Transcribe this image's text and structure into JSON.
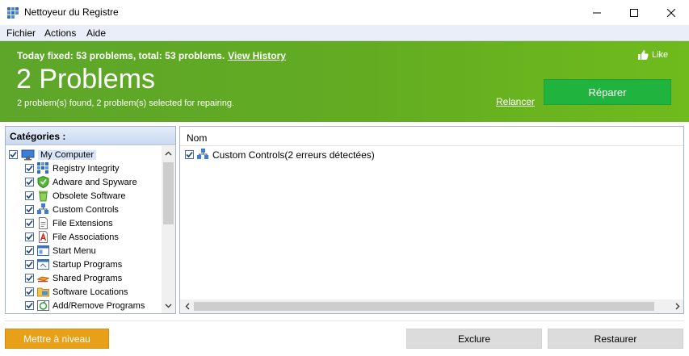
{
  "window": {
    "title": "Nettoyeur du Registre"
  },
  "menu": {
    "items": [
      "Fichier",
      "Actions",
      "Aide"
    ]
  },
  "banner": {
    "today_text": "Today fixed: 53 problems, total: 53 problems.",
    "view_history": "View History",
    "like": "Like",
    "problems_title": "2 Problems",
    "subtitle": "2 problem(s) found, 2 problem(s) selected for repairing.",
    "relancer": "Relancer",
    "repair_button": "Réparer",
    "bg_color": "#62ab22",
    "repair_color": "#20b33d"
  },
  "categories": {
    "header": "Catégories :",
    "root": "My Computer",
    "items": [
      {
        "label": "Registry Integrity",
        "icon": "registry-integrity-icon"
      },
      {
        "label": "Adware and Spyware",
        "icon": "adware-shield-icon"
      },
      {
        "label": "Obsolete Software",
        "icon": "trash-bin-icon"
      },
      {
        "label": "Custom Controls",
        "icon": "custom-controls-icon"
      },
      {
        "label": "File Extensions",
        "icon": "file-extension-icon"
      },
      {
        "label": "File Associations",
        "icon": "file-association-icon"
      },
      {
        "label": "Start Menu",
        "icon": "start-menu-icon"
      },
      {
        "label": "Startup Programs",
        "icon": "startup-programs-icon"
      },
      {
        "label": "Shared Programs",
        "icon": "shared-programs-icon"
      },
      {
        "label": "Software Locations",
        "icon": "folder-icon"
      },
      {
        "label": "Add/Remove Programs",
        "icon": "add-remove-programs-icon"
      }
    ]
  },
  "results": {
    "column": "Nom",
    "rows": [
      {
        "label": "Custom Controls(2 erreurs détectées)"
      }
    ]
  },
  "footer": {
    "upgrade": "Mettre à niveau",
    "exclude": "Exclure",
    "restore": "Restaurer",
    "upgrade_color": "#e8a019"
  }
}
